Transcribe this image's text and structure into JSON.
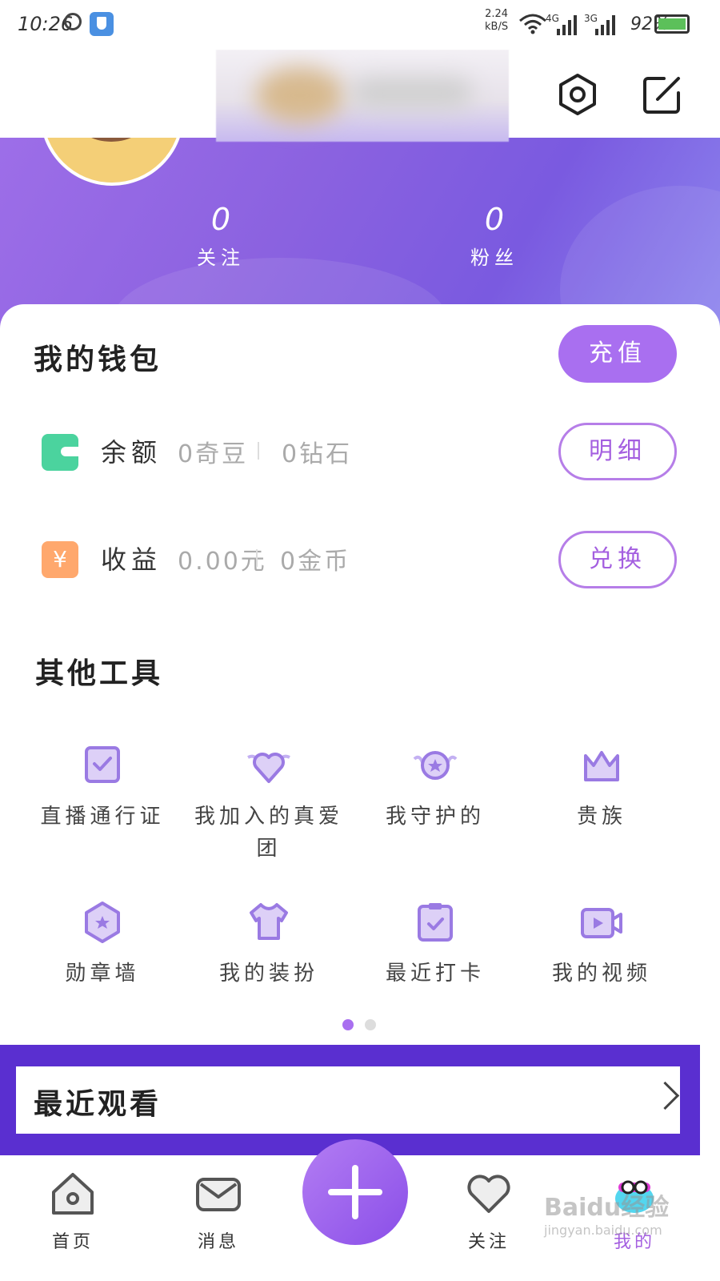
{
  "statusbar": {
    "time": "10:26",
    "speed": "2.24",
    "speed_unit": "kB/S",
    "net1": "4G",
    "net2": "3G",
    "battery": "92%"
  },
  "stats": {
    "following_count": "0",
    "following_label": "关注",
    "fans_count": "0",
    "fans_label": "粉丝"
  },
  "wallet": {
    "title": "我的钱包",
    "recharge_label": "充值",
    "balance": {
      "label": "余额",
      "beans": "0奇豆",
      "diamonds": "0钻石",
      "button": "明细"
    },
    "income": {
      "label": "收益",
      "yuan": "0.00元",
      "coins": "0金币",
      "button": "兑换",
      "icon_glyph": "¥"
    }
  },
  "tools": {
    "title": "其他工具",
    "items": [
      {
        "label": "直播通行证",
        "icon": "pass-icon"
      },
      {
        "label": "我加入的真爱团",
        "icon": "heart-wings-icon"
      },
      {
        "label": "我守护的",
        "icon": "guard-star-icon"
      },
      {
        "label": "贵族",
        "icon": "crown-icon"
      },
      {
        "label": "勋章墙",
        "icon": "medal-icon"
      },
      {
        "label": "我的装扮",
        "icon": "tshirt-icon"
      },
      {
        "label": "最近打卡",
        "icon": "clipboard-check-icon"
      },
      {
        "label": "我的视频",
        "icon": "video-icon"
      }
    ],
    "page_dots": {
      "active": 1,
      "total": 2
    }
  },
  "recent": {
    "title": "最近观看"
  },
  "nav": {
    "items": [
      {
        "label": "首页",
        "icon": "home-icon"
      },
      {
        "label": "消息",
        "icon": "mail-icon"
      },
      {
        "label": "关注",
        "icon": "heart-icon"
      },
      {
        "label": "我的",
        "icon": "profile-icon"
      }
    ],
    "active_index": 3
  },
  "watermark": {
    "text": "Baidu经验",
    "sub": "jingyan.baidu.com"
  },
  "colors": {
    "accent": "#a96ff0",
    "banner": "#8b62e0",
    "highlight_frame": "#5a2fd0",
    "balance_icon": "#4bd39e",
    "income_icon": "#ffa86d"
  }
}
